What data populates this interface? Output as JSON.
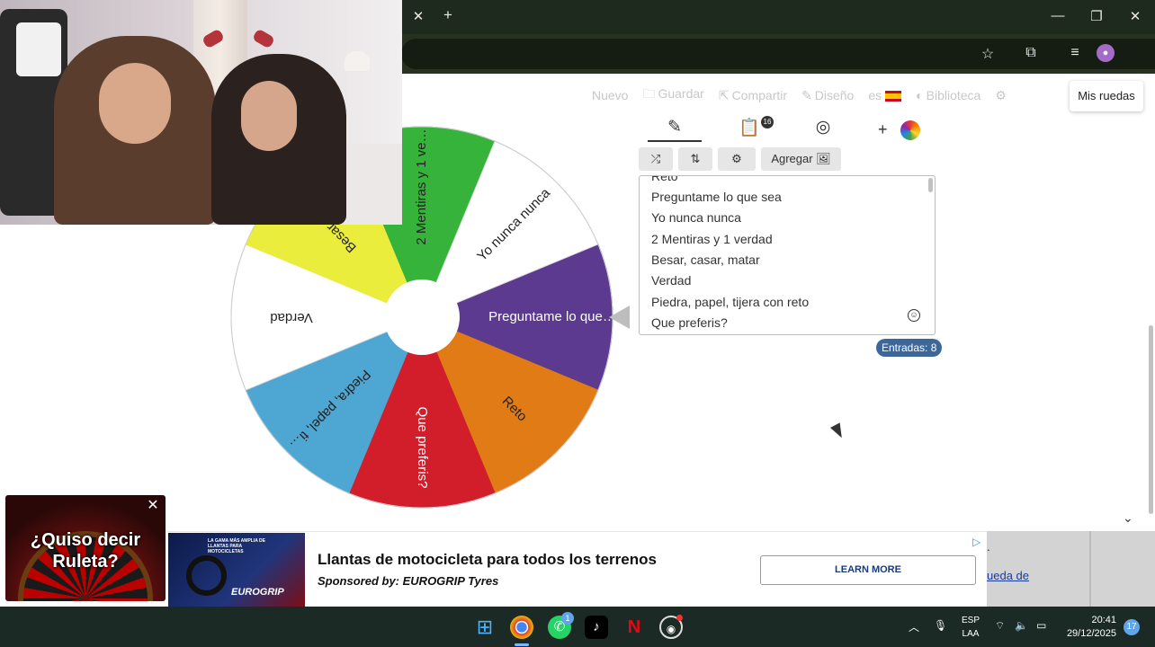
{
  "browser": {
    "tab_close": "✕",
    "new_tab": "+",
    "window_controls": [
      "—",
      "❐",
      "✕"
    ],
    "toolbar_icons": [
      "star-icon",
      "extensions-icon",
      "media-icon"
    ]
  },
  "nav": {
    "items": [
      {
        "label": "Nuevo",
        "icon": ""
      },
      {
        "label": "Guardar",
        "icon": "🗀"
      },
      {
        "label": "Compartir",
        "icon": "⇱"
      },
      {
        "label": "Diseño",
        "icon": "✎"
      },
      {
        "label": "es",
        "icon": ""
      },
      {
        "label": "Biblioteca",
        "icon": "◐"
      }
    ],
    "my_wheels": "Mis ruedas"
  },
  "editor": {
    "tabs": [
      {
        "name": "pencil",
        "glyph": "✎"
      },
      {
        "name": "clipboard",
        "glyph": "📋"
      },
      {
        "name": "eye-off",
        "glyph": "◎"
      }
    ],
    "clipboard_badge": "16",
    "add_color": "+",
    "buttons": {
      "shuffle": "⤮",
      "sort": "⇅",
      "settings": "⚙",
      "add": "Agregar 🖼"
    },
    "entries": [
      "Reto",
      "Preguntame lo que sea",
      "Yo nunca nunca",
      "2 Mentiras y 1 verdad",
      "Besar, casar, matar",
      "Verdad",
      "Piedra, papel, tijera con reto",
      "Que preferis?"
    ],
    "emoji": "☺",
    "count": "Entradas: 8"
  },
  "wheel": {
    "segments": [
      {
        "label": "Preguntame lo que…",
        "color": "#5b3a8f",
        "text": "#ffffff"
      },
      {
        "label": "Reto",
        "color": "#e07b16",
        "text": "#222222"
      },
      {
        "label": "Que preferis?",
        "color": "#d21e2b",
        "text": "#ffffff"
      },
      {
        "label": "Piedra, papel, ti…",
        "color": "#4ea6d3",
        "text": "#222222"
      },
      {
        "label": "Verdad",
        "color": "#ffffff",
        "text": "#222222"
      },
      {
        "label": "Besar, ca…",
        "color": "#eaed3c",
        "text": "#222222"
      },
      {
        "label": "2 Mentiras y 1 ve…",
        "color": "#36b33a",
        "text": "#222222"
      },
      {
        "label": "Yo nunca nunca",
        "color": "#ffffff",
        "text": "#222222"
      }
    ]
  },
  "ad": {
    "title": "Llantas de motocicleta para todos los terrenos",
    "sponsor": "Sponsored by: EUROGRIP Tyres",
    "cta": "LEARN MORE",
    "brand": "EUROGRIP",
    "image_text": "LA GAMA MÁS AMPLIA DE LLANTAS PARA MOTOCICLETAS",
    "right_link": "ueda de",
    "right_dot": "."
  },
  "promo": {
    "line1": "¿Quiso decir",
    "line2": "Ruleta?",
    "close": "✕"
  },
  "taskbar": {
    "whatsapp_badge": "1",
    "lang1": "ESP",
    "lang2": "LAA",
    "time": "20:41",
    "date": "29/12/2025",
    "notifications": "17"
  }
}
